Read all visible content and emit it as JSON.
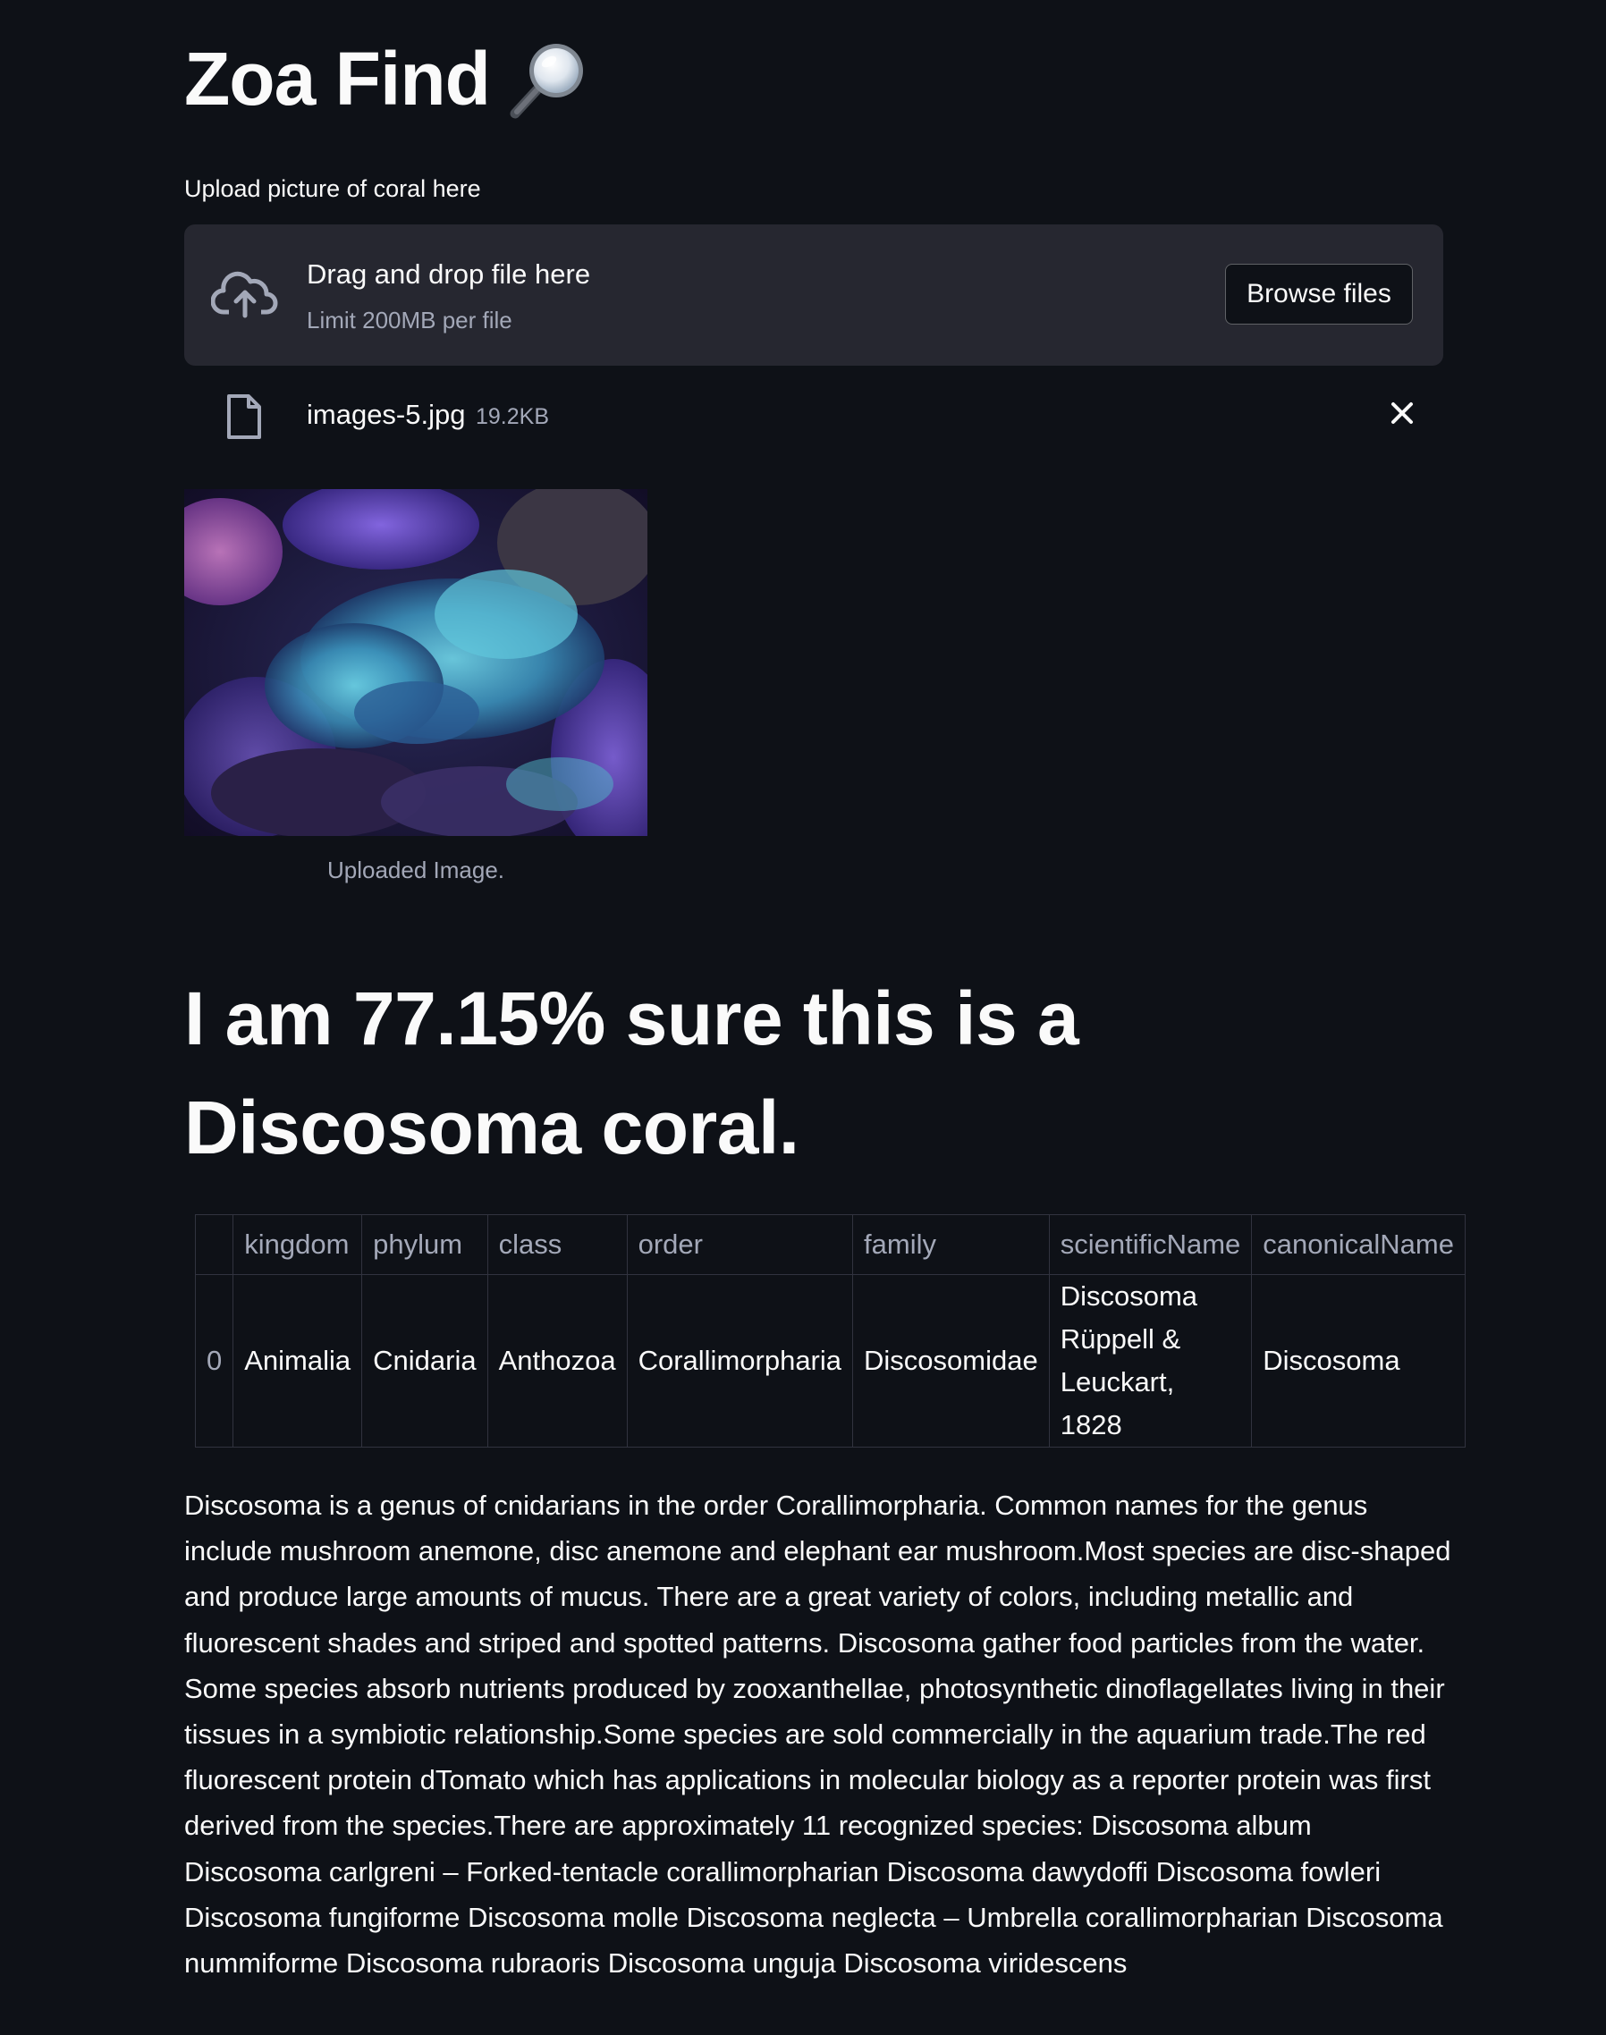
{
  "app": {
    "title": "Zoa Find"
  },
  "uploader": {
    "label": "Upload picture of coral here",
    "drop_title": "Drag and drop file here",
    "drop_limit": "Limit 200MB per file",
    "browse_label": "Browse files"
  },
  "file": {
    "name": "images-5.jpg",
    "size": "19.2KB"
  },
  "image": {
    "caption": "Uploaded Image."
  },
  "result": {
    "text": "I am 77.15% sure this is a Discosoma coral."
  },
  "table": {
    "columns": [
      "",
      "kingdom",
      "phylum",
      "class",
      "order",
      "family",
      "scientificName",
      "canonicalName"
    ],
    "row": {
      "index": "0",
      "kingdom": "Animalia",
      "phylum": "Cnidaria",
      "class": "Anthozoa",
      "order": "Corallimorpharia",
      "family": "Discosomidae",
      "scientificName": "Discosoma Rüppell & Leuckart, 1828",
      "canonicalName": "Discosoma"
    }
  },
  "description": "Discosoma is a genus of cnidarians in the order Corallimorpharia. Common names for the genus include mushroom anemone, disc anemone and elephant ear mushroom.Most species are disc-shaped and produce large amounts of mucus. There are a great variety of colors, including metallic and fluorescent shades and striped and spotted patterns. Discosoma gather food particles from the water. Some species absorb nutrients produced by zooxanthellae, photosynthetic dinoflagellates living in their tissues in a symbiotic relationship.Some species are sold commercially in the aquarium trade.The red fluorescent protein dTomato which has applications in molecular biology as a reporter protein was first derived from the species.There are approximately 11 recognized species: Discosoma album Discosoma carlgreni – Forked-tentacle corallimorpharian Discosoma dawydoffi Discosoma fowleri Discosoma fungiforme Discosoma molle Discosoma neglecta – Umbrella corallimorpharian Discosoma nummiforme Discosoma rubraoris Discosoma unguja Discosoma viridescens",
  "icons": {
    "title_icon": "magnifying-glass-icon",
    "upload_icon": "cloud-upload-icon",
    "file_icon": "file-icon",
    "remove_icon": "close-icon"
  },
  "colors": {
    "background": "#0e1117",
    "dropzone": "#262730",
    "text": "#fafafa",
    "muted": "#a3a8b8",
    "border": "#31333f"
  }
}
